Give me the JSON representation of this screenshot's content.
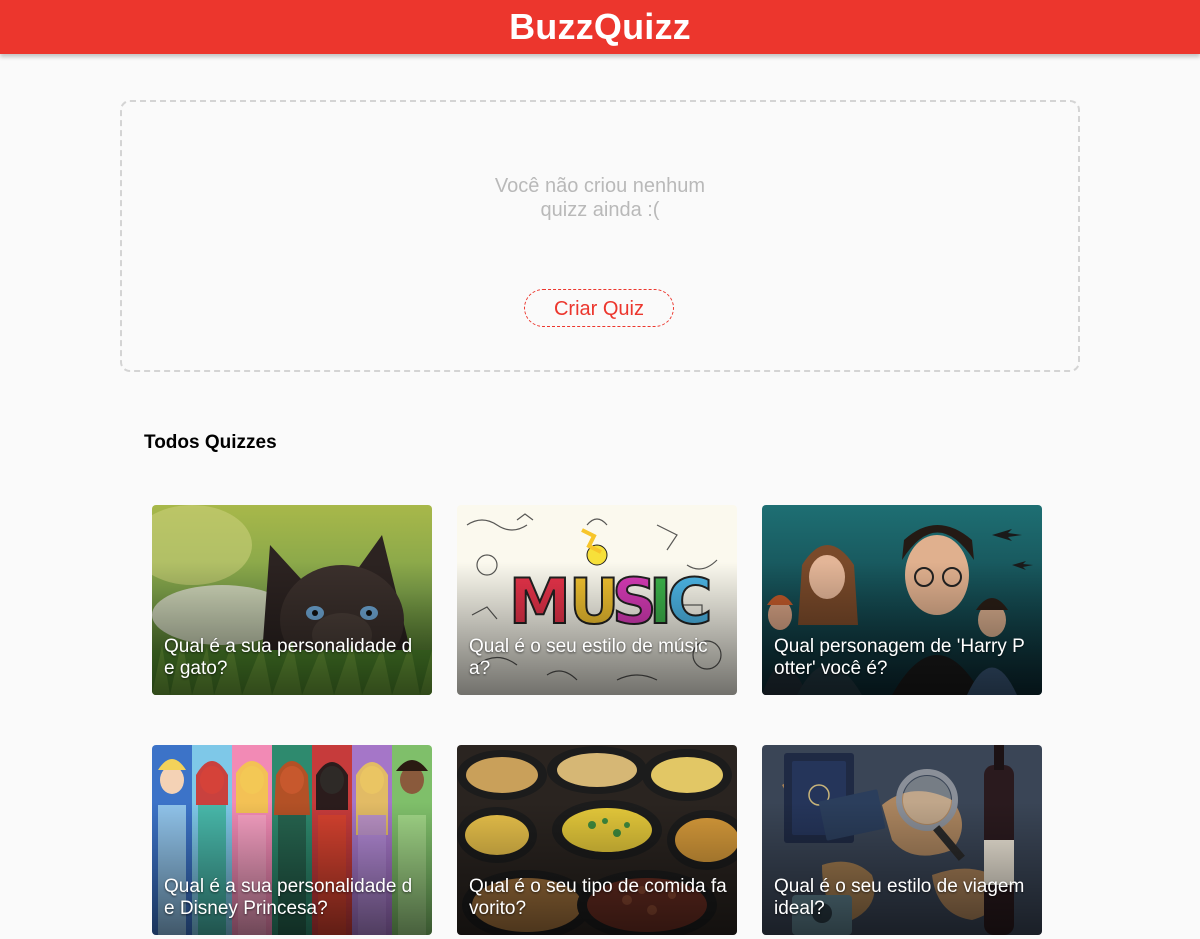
{
  "header": {
    "brand": "BuzzQuizz"
  },
  "user_quizzes": {
    "empty_line1": "Você não criou nenhum",
    "empty_line2": "quizz ainda :(",
    "create_button": "Criar Quiz"
  },
  "all_quizzes": {
    "title": "Todos Quizzes",
    "cards": [
      {
        "title": "Qual é a sua personalidade de gato?",
        "image": "cat-photo"
      },
      {
        "title": "Qual é o seu estilo de música?",
        "image": "music-doodle"
      },
      {
        "title": "Qual personagem de 'Harry Potter' você é?",
        "image": "harry-potter-poster"
      },
      {
        "title": "Qual é a sua personalidade de Disney Princesa?",
        "image": "disney-princesses"
      },
      {
        "title": "Qual é o seu tipo de comida favorito?",
        "image": "food-trays"
      },
      {
        "title": "Qual é o seu estilo de viagem ideal?",
        "image": "travel-map"
      }
    ]
  },
  "colors": {
    "accent": "#EC362D",
    "background": "#FAFAFA",
    "muted_text": "#B9B9B9",
    "dashed_border": "#D4D4D4"
  }
}
